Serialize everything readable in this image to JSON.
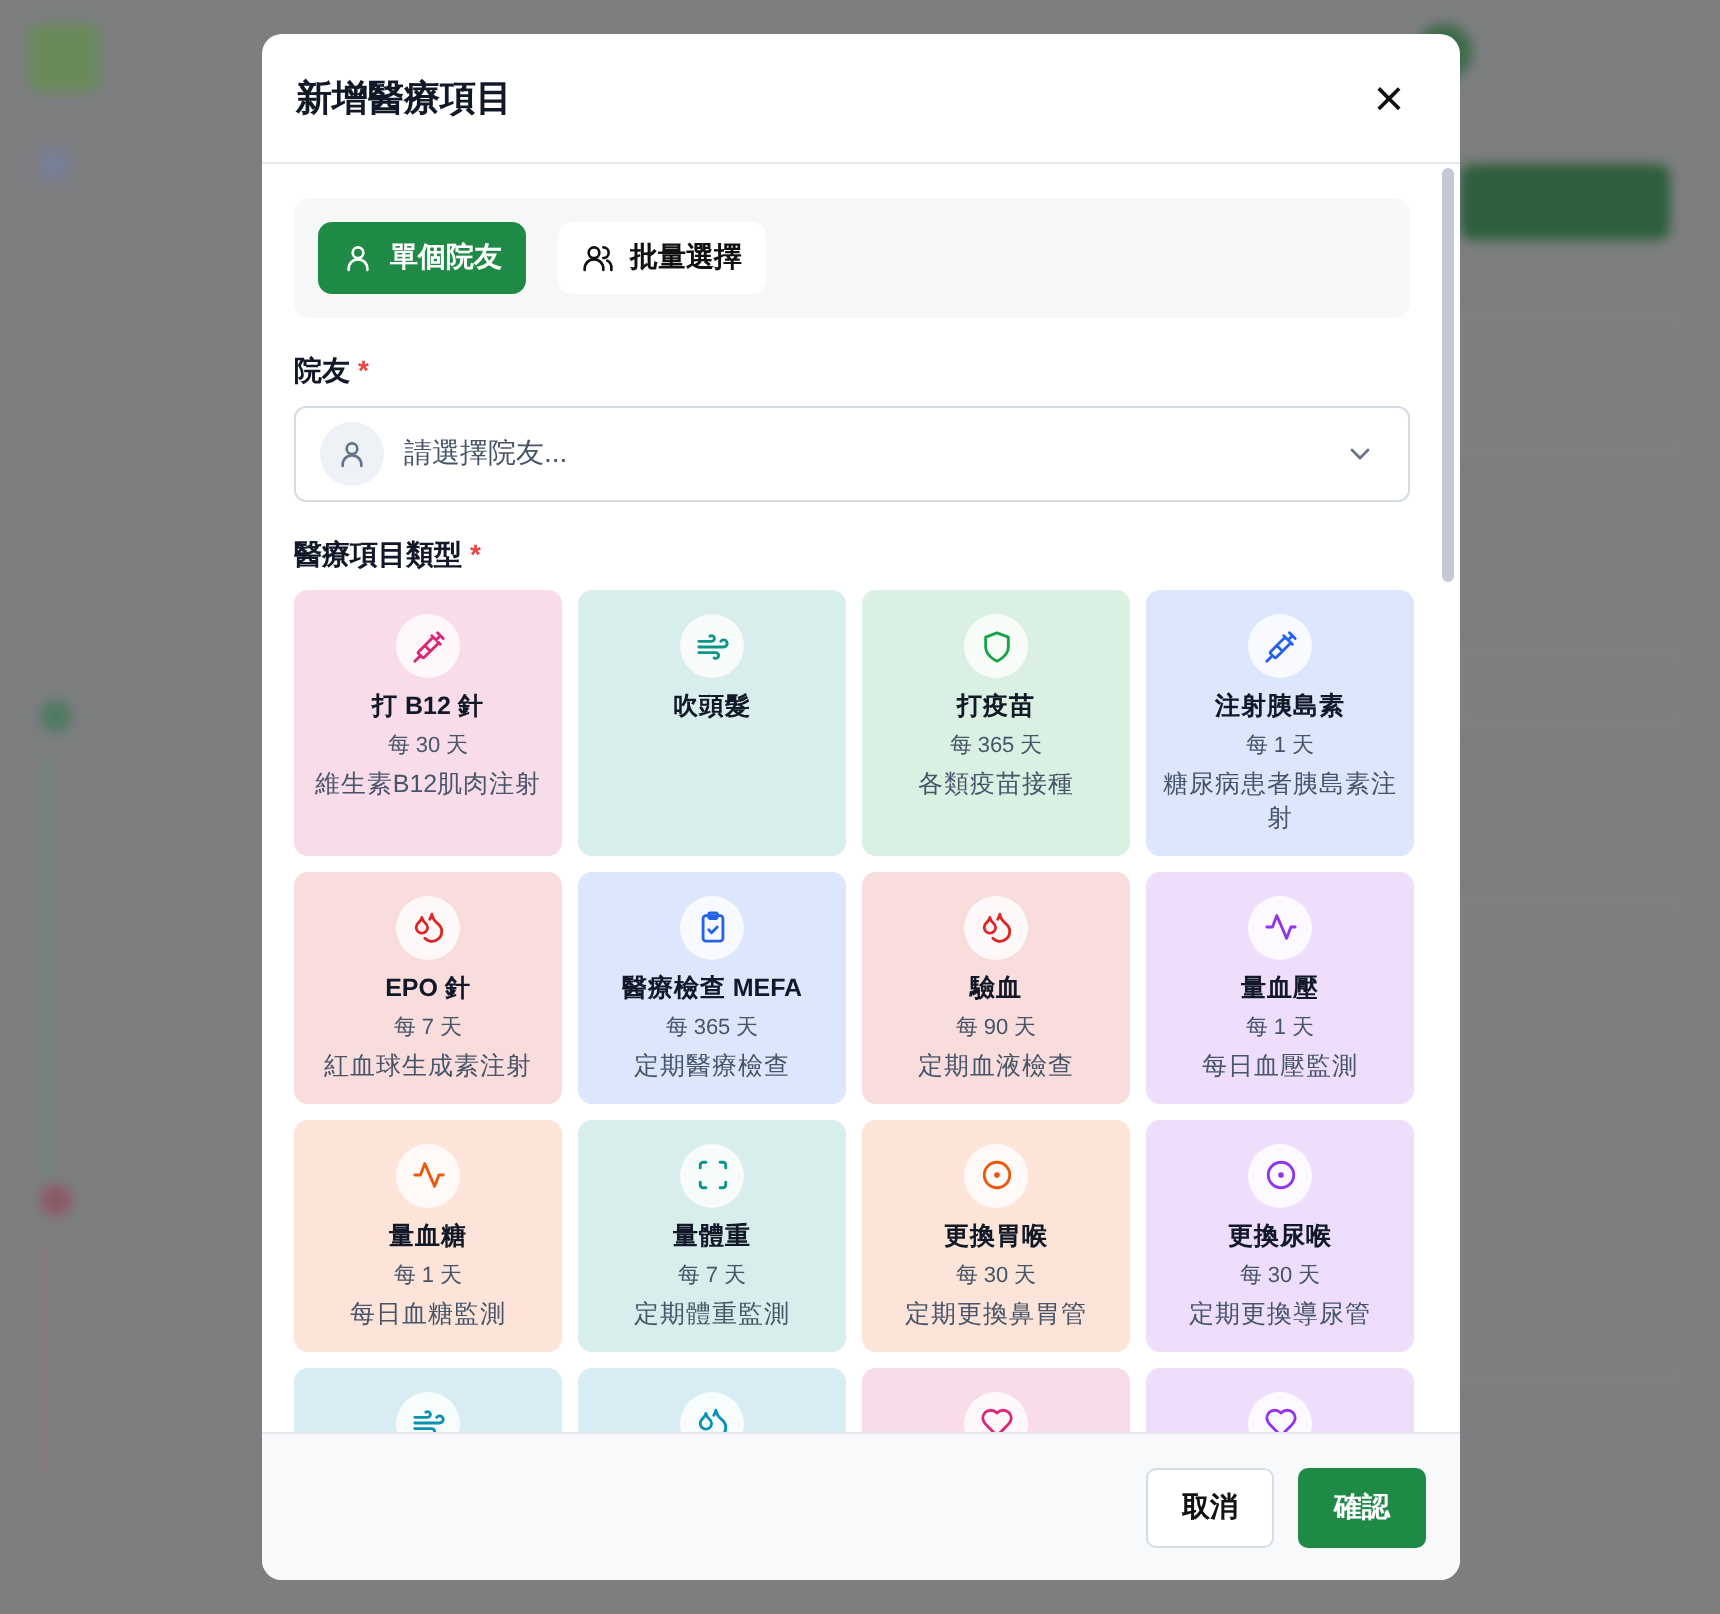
{
  "dialog": {
    "title": "新增醫療項目",
    "close": "×"
  },
  "modes": [
    {
      "label": "單個院友",
      "kind": "single",
      "selected": true
    },
    {
      "label": "批量選擇",
      "kind": "group",
      "selected": false
    }
  ],
  "resident": {
    "label": "院友",
    "required": "*",
    "placeholder": "請選擇院友..."
  },
  "types": {
    "label": "醫療項目類型",
    "required": "*",
    "items": [
      {
        "kind": "syringe",
        "color": "#db2777",
        "name": "打 B12 針",
        "frequency": "每 30 天",
        "description": "維生素B12肌肉注射"
      },
      {
        "kind": "wind",
        "color": "#0d9488",
        "name": "吹頭髮"
      },
      {
        "kind": "shield",
        "color": "#16a34a",
        "name": "打疫苗",
        "frequency": "每 365 天",
        "description": "各類疫苗接種"
      },
      {
        "kind": "syringe",
        "color": "#2563eb",
        "name": "注射胰島素",
        "frequency": "每 1 天",
        "description": "糖尿病患者胰島素注射"
      },
      {
        "kind": "drops",
        "color": "#dc2626",
        "name": "EPO 針",
        "frequency": "每 7 天",
        "description": "紅血球生成素注射"
      },
      {
        "kind": "clipboard",
        "color": "#2563eb",
        "name": "醫療檢查 MEFA",
        "frequency": "每 365 天",
        "description": "定期醫療檢查"
      },
      {
        "kind": "drops",
        "color": "#dc2626",
        "name": "驗血",
        "frequency": "每 90 天",
        "description": "定期血液檢查"
      },
      {
        "kind": "pulse",
        "color": "#9333ea",
        "name": "量血壓",
        "frequency": "每 1 天",
        "description": "每日血壓監測"
      },
      {
        "kind": "pulse",
        "color": "#ea580c",
        "name": "量血糖",
        "frequency": "每 1 天",
        "description": "每日血糖監測"
      },
      {
        "kind": "scan",
        "color": "#0d9488",
        "name": "量體重",
        "frequency": "每 7 天",
        "description": "定期體重監測"
      },
      {
        "kind": "target",
        "color": "#ea580c",
        "name": "更換胃喉",
        "frequency": "每 30 天",
        "description": "定期更換鼻胃管"
      },
      {
        "kind": "target",
        "color": "#9333ea",
        "name": "更換尿喉",
        "frequency": "每 30 天",
        "description": "定期更換導尿管"
      },
      {
        "kind": "wind",
        "color": "#0891b2"
      },
      {
        "kind": "drops",
        "color": "#0891b2"
      },
      {
        "kind": "heart",
        "color": "#db2777"
      },
      {
        "kind": "heart",
        "color": "#9333ea"
      }
    ]
  },
  "buttons": [
    {
      "label": "取消",
      "kind": "secondary"
    },
    {
      "label": "確認",
      "kind": "primary"
    }
  ]
}
